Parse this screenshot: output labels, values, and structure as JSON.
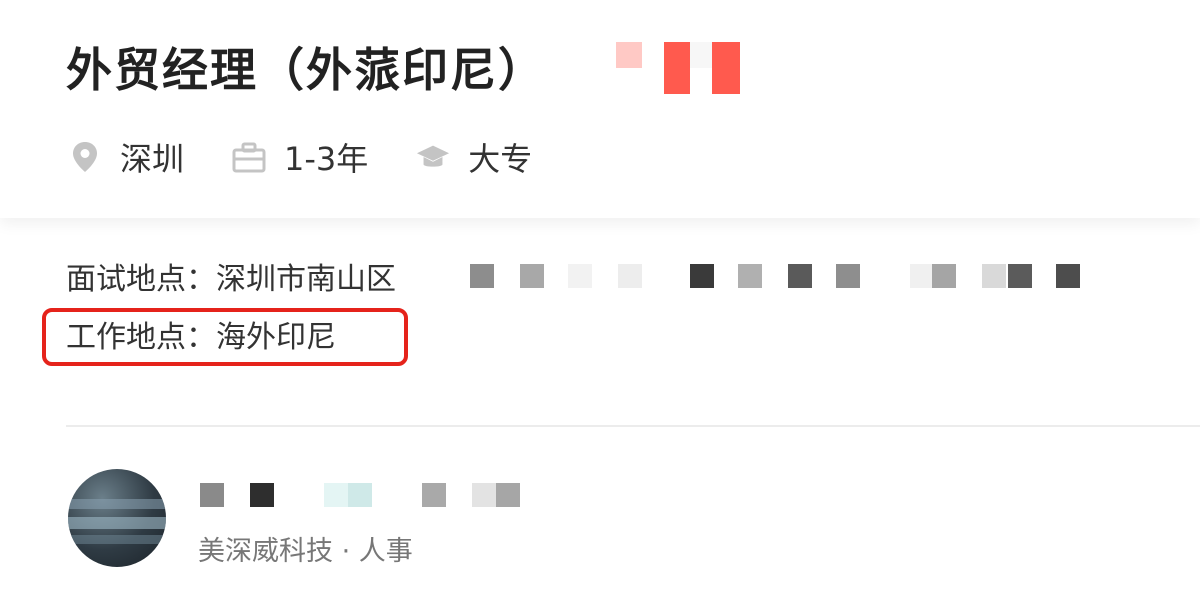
{
  "job": {
    "title": "外贸经理（外蒎印尼）",
    "city": "深圳",
    "experience": "1-3年",
    "education": "大专"
  },
  "icons": {
    "city": "location-pin-icon",
    "experience": "briefcase-icon",
    "education": "graduation-cap-icon"
  },
  "locations": {
    "interview_label": "面试地点：",
    "interview_value": "深圳市南山区",
    "work_label": "工作地点：",
    "work_value": "海外印尼"
  },
  "recruiter": {
    "company_role": "美深威科技 · 人事"
  },
  "colors": {
    "highlight_border": "#e5231b",
    "salary_accent": "#ff5a4e",
    "text_primary": "#222222",
    "text_secondary": "#777777",
    "icon_gray": "#c4c4c4"
  }
}
